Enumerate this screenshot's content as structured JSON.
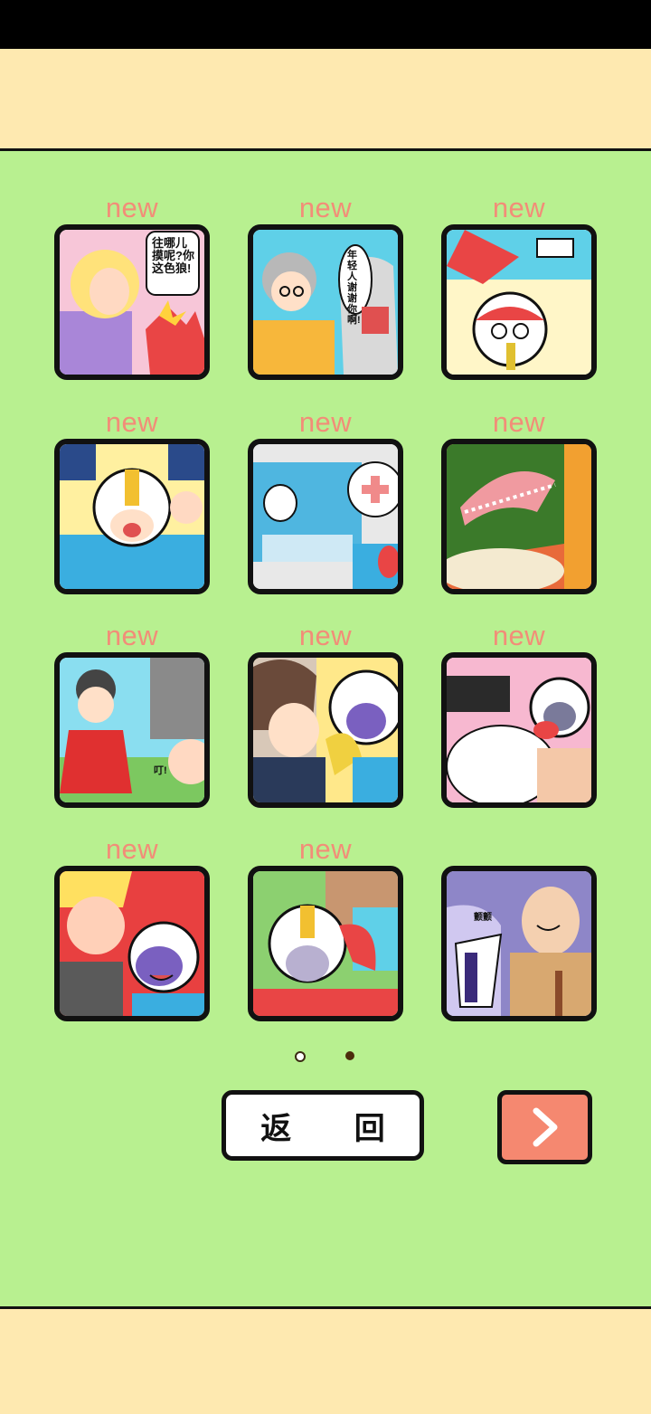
{
  "status_bar": {},
  "gallery": {
    "badge_text": "new",
    "items": [
      {
        "badge": "new",
        "caption": "往哪儿摸呢?你这色狼!"
      },
      {
        "badge": "new",
        "caption": "年轻人谢谢你啊!"
      },
      {
        "badge": "new",
        "caption": ""
      },
      {
        "badge": "new",
        "caption": ""
      },
      {
        "badge": "new",
        "caption": ""
      },
      {
        "badge": "new",
        "caption": ""
      },
      {
        "badge": "new",
        "caption": "叮!"
      },
      {
        "badge": "new",
        "caption": ""
      },
      {
        "badge": "new",
        "caption": ""
      },
      {
        "badge": "new",
        "caption": ""
      },
      {
        "badge": "new",
        "caption": ""
      },
      {
        "badge": "",
        "caption": "颤颤"
      }
    ]
  },
  "pagination": {
    "current_page": 2,
    "total_pages": 2
  },
  "buttons": {
    "back_label": "返 回",
    "next_icon": "chevron-right-icon"
  },
  "colors": {
    "background": "#b8f090",
    "band": "#fee9b0",
    "badge": "#f28d78",
    "next_button": "#f58870"
  }
}
